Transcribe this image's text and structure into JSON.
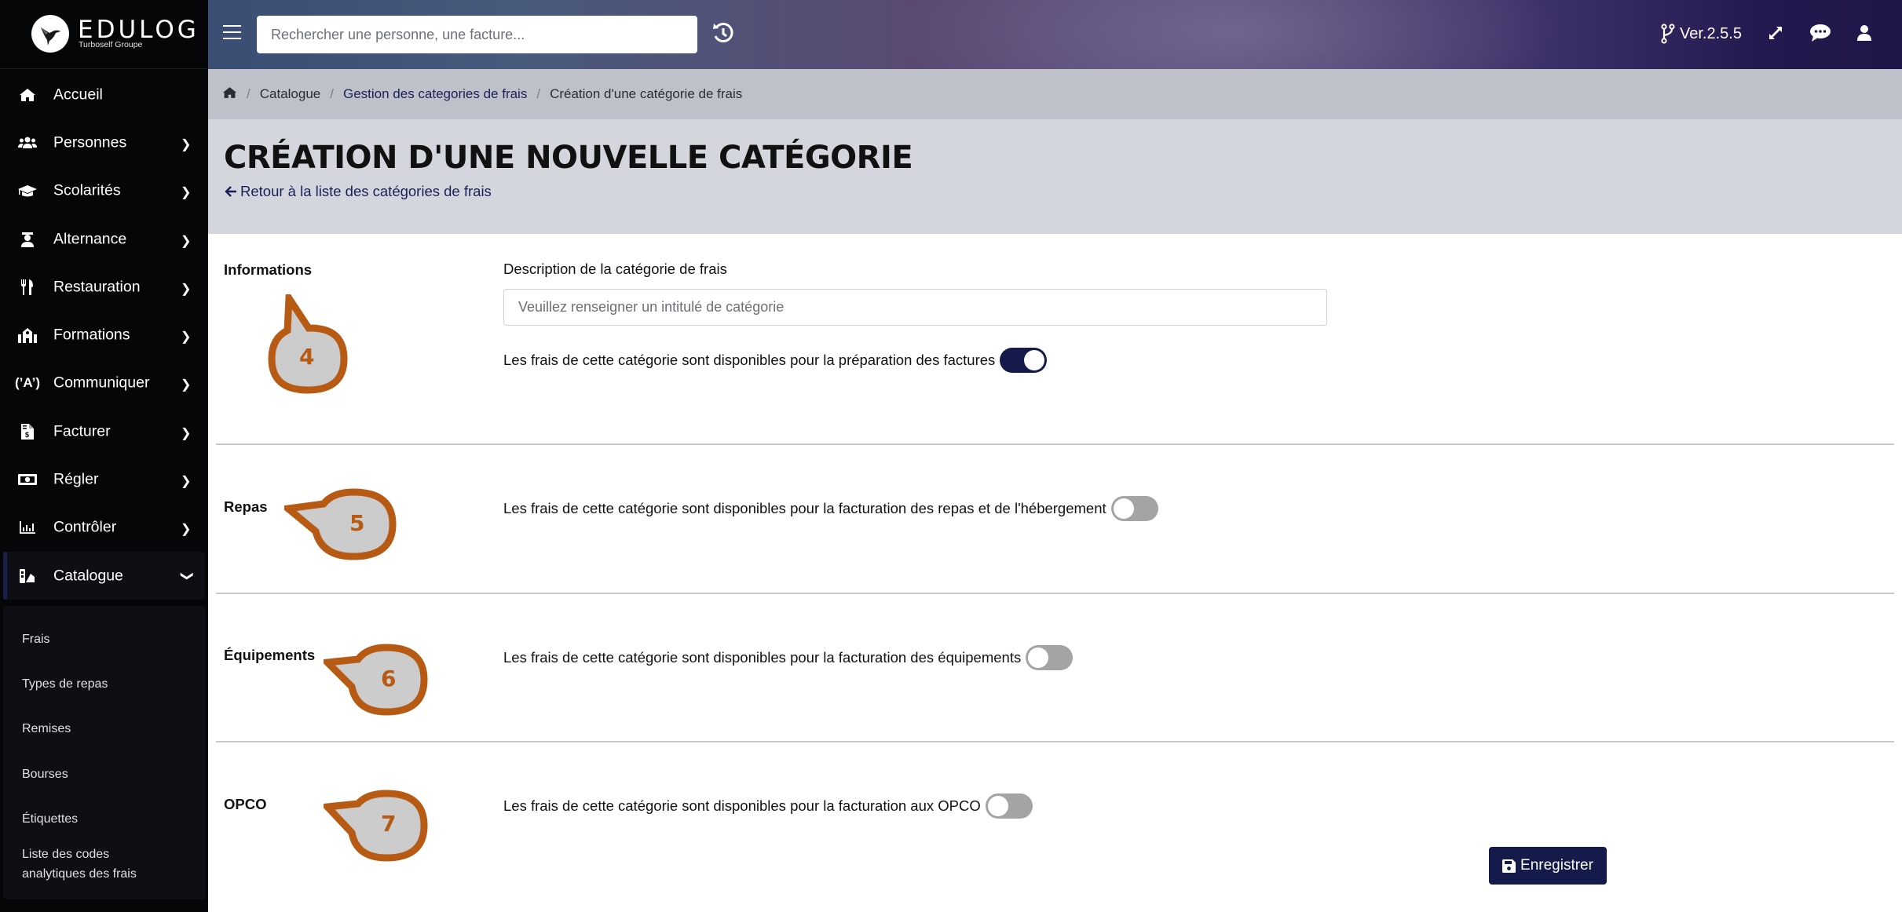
{
  "app": {
    "brand": "EDULOG",
    "brand_sub": "Turboself Groupe"
  },
  "header": {
    "search_placeholder": "Rechercher une personne, une facture...",
    "version": "Ver.2.5.5",
    "icons": [
      "menu-icon",
      "history-icon",
      "git-branch-icon",
      "expand-icon",
      "chat-icon",
      "user-icon"
    ]
  },
  "sidebar": {
    "items": [
      {
        "label": "Accueil",
        "icon": "home-icon",
        "has_children": false
      },
      {
        "label": "Personnes",
        "icon": "users-icon",
        "has_children": true
      },
      {
        "label": "Scolarités",
        "icon": "graduation-cap-icon",
        "has_children": true
      },
      {
        "label": "Alternance",
        "icon": "user-graduate-icon",
        "has_children": true
      },
      {
        "label": "Restauration",
        "icon": "utensils-icon",
        "has_children": true
      },
      {
        "label": "Formations",
        "icon": "school-icon",
        "has_children": true
      },
      {
        "label": "Communiquer",
        "icon": "broadcast-icon",
        "has_children": true
      },
      {
        "label": "Facturer",
        "icon": "invoice-icon",
        "has_children": true
      },
      {
        "label": "Régler",
        "icon": "money-bill-icon",
        "has_children": true
      },
      {
        "label": "Contrôler",
        "icon": "chart-bar-icon",
        "has_children": true
      },
      {
        "label": "Catalogue",
        "icon": "swatchbook-icon",
        "has_children": true,
        "expanded": true
      }
    ],
    "catalogue_sub": [
      "Frais",
      "Types de repas",
      "Remises",
      "Bourses",
      "Étiquettes",
      "Liste des codes analytiques des frais"
    ]
  },
  "breadcrumb": {
    "items": [
      "Catalogue",
      "Gestion des categories de frais",
      "Création d'une catégorie de frais"
    ]
  },
  "page": {
    "title": "CRÉATION D'UNE NOUVELLE CATÉGORIE",
    "back_link": "Retour à la liste des catégories de frais"
  },
  "form": {
    "sections": [
      {
        "label": "Informations",
        "field_label": "Description de la catégorie de frais",
        "input_value": "",
        "input_placeholder": "Veuillez renseigner un intitulé de catégorie",
        "toggle_label": "Les frais de cette catégorie sont disponibles pour la préparation des factures",
        "toggle_on": true,
        "callout": "4"
      },
      {
        "label": "Repas",
        "toggle_label": "Les frais de cette catégorie sont disponibles pour la facturation des repas et de l'hébergement",
        "toggle_on": false,
        "callout": "5"
      },
      {
        "label": "Équipements",
        "toggle_label": "Les frais de cette catégorie sont disponibles pour la facturation des équipements",
        "toggle_on": false,
        "callout": "6"
      },
      {
        "label": "OPCO",
        "toggle_label": "Les frais de cette catégorie sont disponibles pour la facturation aux OPCO",
        "toggle_on": false,
        "callout": "7"
      }
    ],
    "save_label": "Enregistrer"
  },
  "colors": {
    "primary": "#141a4a",
    "callout_stroke": "#b65a14",
    "callout_fill": "#cccccc",
    "toggle_off": "#a4a4a4"
  }
}
